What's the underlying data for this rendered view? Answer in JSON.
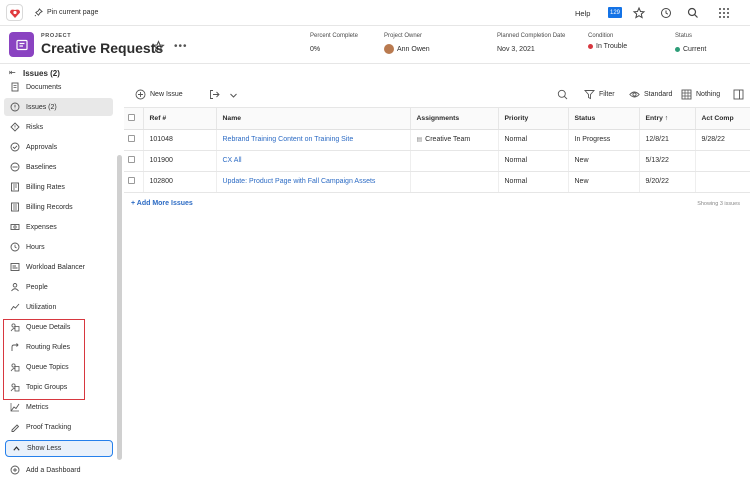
{
  "topbar": {
    "pin_label": "Pin current page",
    "help_label": "Help",
    "notification_count": "129"
  },
  "project": {
    "type_label": "PROJECT",
    "title": "Creative Requests",
    "more_label": "•••",
    "percent_complete_label": "Percent Complete",
    "percent_complete_value": "0%",
    "owner_label": "Project Owner",
    "owner_value": "Ann Owen",
    "planned_completion_label": "Planned Completion Date",
    "planned_completion_value": "Nov 3, 2021",
    "condition_label": "Condition",
    "condition_value": "In Trouble",
    "condition_color": "#d7373f",
    "status_label": "Status",
    "status_value": "Current",
    "status_color": "#2d9d78"
  },
  "sidebar": {
    "header_title": "Issues (2)",
    "items": [
      {
        "label": "Documents",
        "icon": "document-icon"
      },
      {
        "label": "Issues (2)",
        "icon": "issue-icon"
      },
      {
        "label": "Risks",
        "icon": "risk-icon"
      },
      {
        "label": "Approvals",
        "icon": "approval-icon"
      },
      {
        "label": "Baselines",
        "icon": "baseline-icon"
      },
      {
        "label": "Billing Rates",
        "icon": "billing-rates-icon"
      },
      {
        "label": "Billing Records",
        "icon": "billing-records-icon"
      },
      {
        "label": "Expenses",
        "icon": "expenses-icon"
      },
      {
        "label": "Hours",
        "icon": "clock-icon"
      },
      {
        "label": "Workload Balancer",
        "icon": "workload-icon"
      },
      {
        "label": "People",
        "icon": "people-icon"
      },
      {
        "label": "Utilization",
        "icon": "utilization-icon"
      },
      {
        "label": "Queue Details",
        "icon": "queue-details-icon"
      },
      {
        "label": "Routing Rules",
        "icon": "routing-rules-icon"
      },
      {
        "label": "Queue Topics",
        "icon": "queue-topics-icon"
      },
      {
        "label": "Topic Groups",
        "icon": "topic-groups-icon"
      },
      {
        "label": "Metrics",
        "icon": "metrics-icon"
      },
      {
        "label": "Proof Tracking",
        "icon": "proof-icon"
      }
    ],
    "show_less_label": "Show Less",
    "add_dashboard_label": "Add a Dashboard"
  },
  "toolbar": {
    "new_issue_label": "New Issue",
    "filter_label": "Filter",
    "view_label": "Standard",
    "grouping_label": "Nothing"
  },
  "table": {
    "headers": [
      "Ref #",
      "Name",
      "Assignments",
      "Priority",
      "Status",
      "Entry",
      "Act Comp"
    ],
    "rows": [
      {
        "ref": "101048",
        "name": "Rebrand Training Content on Training Site",
        "assignment": "Creative Team",
        "priority": "Normal",
        "status": "In Progress",
        "entry": "12/8/21",
        "act_comp": "9/28/22"
      },
      {
        "ref": "101900",
        "name": "CX All",
        "assignment": "",
        "priority": "Normal",
        "status": "New",
        "entry": "5/13/22",
        "act_comp": ""
      },
      {
        "ref": "102800",
        "name": "Update: Product Page with Fall Campaign Assets",
        "assignment": "",
        "priority": "Normal",
        "status": "New",
        "entry": "9/20/22",
        "act_comp": ""
      }
    ],
    "add_more_label": "+ Add More Issues",
    "showing_label": "Showing 3 issues"
  }
}
